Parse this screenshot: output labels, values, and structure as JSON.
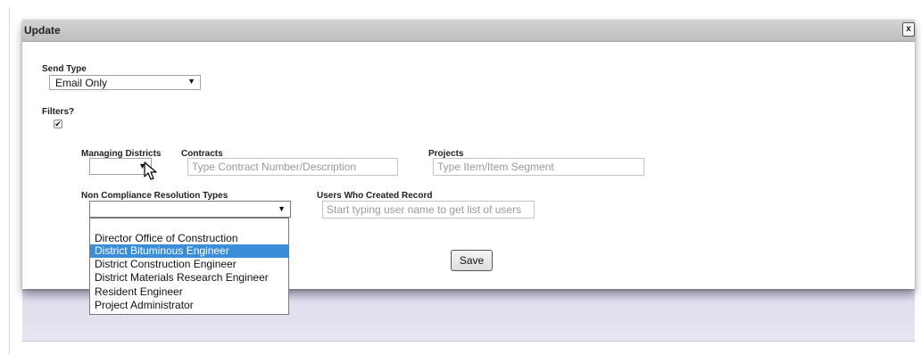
{
  "dialog": {
    "title": "Update",
    "close_label": "x"
  },
  "send_type": {
    "label": "Send Type",
    "selected": "Email Only"
  },
  "filters": {
    "label": "Filters?",
    "checked": true,
    "check_mark": "✔"
  },
  "managing_districts": {
    "label": "Managing Districts",
    "selected": ""
  },
  "contracts": {
    "label": "Contracts",
    "placeholder": "Type Contract Number/Description"
  },
  "projects": {
    "label": "Projects",
    "placeholder": "Type Item/Item Segment"
  },
  "non_compliance": {
    "label": "Non Compliance Resolution Types",
    "selected": "",
    "options": [
      "",
      "Director Office of Construction",
      "District Bituminous Engineer",
      "District Construction Engineer",
      "District Materials Research Engineer",
      "Resident Engineer",
      "Project Administrator"
    ],
    "highlighted_index": 2
  },
  "users_created": {
    "label": "Users Who Created Record",
    "placeholder": "Start typing user name to get list of users"
  },
  "actions": {
    "save_label": "Save"
  },
  "colors": {
    "highlight": "#3b8cd9",
    "titlebar": "#c8c8c8",
    "backdrop": "#dcdcea"
  }
}
